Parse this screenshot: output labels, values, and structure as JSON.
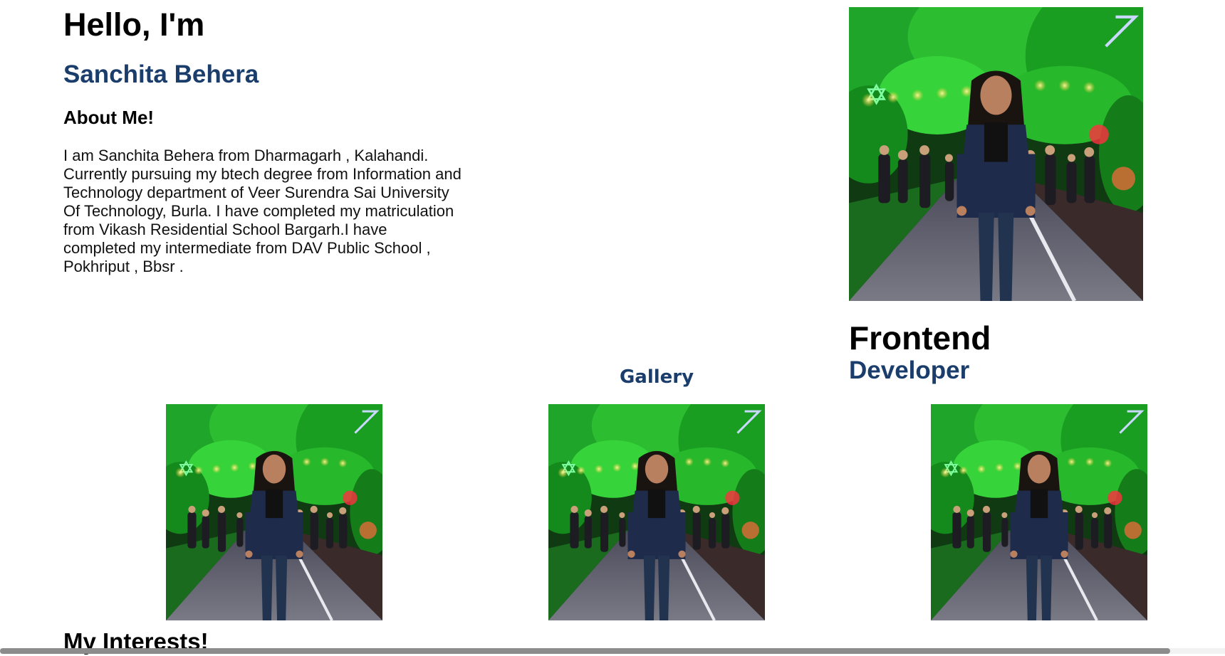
{
  "hero": {
    "greeting": "Hello, I'm",
    "name": "Sanchita Behera",
    "about_heading": "About Me!",
    "about_text": "I am Sanchita Behera from Dharmagarh , Kalahandi. Currently pursuing my btech degree from Information and Technology department of Veer Surendra Sai University Of Technology, Burla. I have completed my matriculation from Vikash Residential School Bargarh.I have completed my intermediate from DAV Public School , Pokhriput , Bbsr ."
  },
  "role": {
    "main": "Frontend",
    "sub": "Developer"
  },
  "gallery": {
    "title": "Gallery",
    "image_count": 3
  },
  "interests": {
    "heading": "My Interests!"
  },
  "colors": {
    "accent": "#1a3d6b",
    "text": "#000000",
    "background": "#ffffff",
    "scrollbar_thumb": "#8c8c8c"
  },
  "scrollbar": {
    "horizontal_visible_fraction": 0.955
  }
}
